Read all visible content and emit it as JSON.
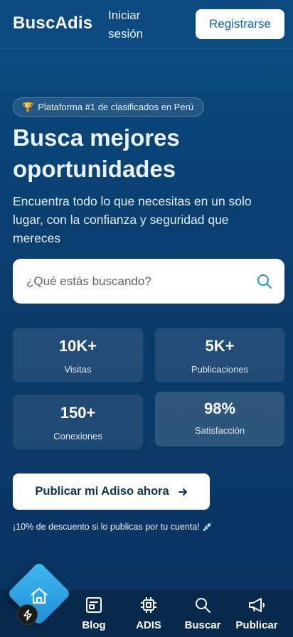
{
  "header": {
    "logo": "BuscAdis",
    "login_label": "Iniciar sesión",
    "register_label": "Registrarse"
  },
  "hero": {
    "badge_icon": "trophy-icon",
    "badge_text": "Plataforma #1 de clasificados en Perú",
    "headline": "Busca mejores oportunidades",
    "subtext": "Encuentra todo lo que necesitas en un solo lugar, con la confianza y seguridad que mereces"
  },
  "search": {
    "placeholder": "¿Qué estás buscando?",
    "value": ""
  },
  "stats": [
    {
      "value": "10K+",
      "label": "Visitas"
    },
    {
      "value": "5K+",
      "label": "Publicaciones"
    },
    {
      "value": "150+",
      "label": "Conexiones"
    },
    {
      "value": "98%",
      "label": "Satisfacción"
    }
  ],
  "cta": {
    "publish_label": "Publicar mi Adiso ahora",
    "discount_text": "¡10% de descuento si lo publicas por tu cuenta! 💉"
  },
  "bottom_nav": {
    "home_icon": "home-icon",
    "items": [
      {
        "label": "Blog",
        "icon": "blog-icon"
      },
      {
        "label": "ADIS",
        "icon": "chip-icon"
      },
      {
        "label": "Buscar",
        "icon": "search-icon"
      },
      {
        "label": "Publicar",
        "icon": "megaphone-icon"
      }
    ]
  },
  "colors": {
    "background": "#0a3e6e",
    "accent": "#0b66b3",
    "home_button": "#2a9fe0",
    "nav_background": "#08294c"
  }
}
